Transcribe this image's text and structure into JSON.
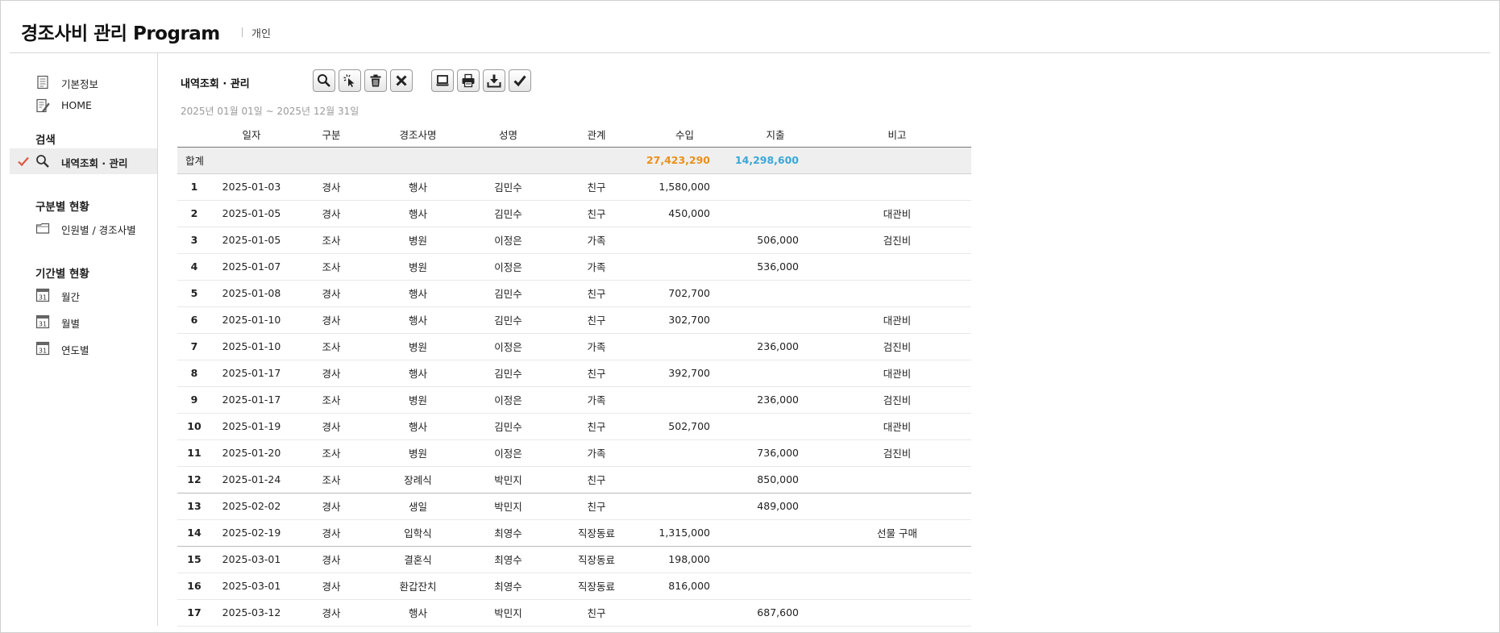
{
  "app": {
    "title": "경조사비 관리 Program",
    "subtitle": "개인"
  },
  "sidebar": {
    "top_items": [
      {
        "label": "기본정보",
        "icon": "document-icon"
      },
      {
        "label": "HOME",
        "icon": "edit-document-icon"
      }
    ],
    "sections": [
      {
        "title": "검색",
        "items": [
          {
            "label": "내역조회 · 관리",
            "icon": "search-icon",
            "active": true
          }
        ]
      },
      {
        "title": "구분별 현황",
        "items": [
          {
            "label": "인원별 / 경조사별",
            "icon": "folder-icon"
          }
        ]
      },
      {
        "title": "기간별 현황",
        "items": [
          {
            "label": "월간",
            "icon": "calendar-icon"
          },
          {
            "label": "월별",
            "icon": "calendar-icon"
          },
          {
            "label": "연도별",
            "icon": "calendar-icon"
          }
        ]
      }
    ],
    "calendar_day": "31"
  },
  "main": {
    "title": "내역조회 · 관리",
    "period": "2025년 01월 01일 ~ 2025년 12월 31일",
    "toolbar": [
      "search-icon",
      "pointer-click-icon",
      "trash-icon",
      "close-icon",
      "laptop-icon",
      "print-icon",
      "download-icon",
      "check-icon"
    ],
    "columns": [
      "일자",
      "구분",
      "경조사명",
      "성명",
      "관계",
      "수입",
      "지출",
      "비고"
    ],
    "total": {
      "label": "합계",
      "income": "27,423,290",
      "expense": "14,298,600"
    },
    "rows": [
      {
        "no": "1",
        "date": "2025-01-03",
        "type": "경사",
        "event": "행사",
        "name": "김민수",
        "relation": "친구",
        "income": "1,580,000",
        "expense": "",
        "note": ""
      },
      {
        "no": "2",
        "date": "2025-01-05",
        "type": "경사",
        "event": "행사",
        "name": "김민수",
        "relation": "친구",
        "income": "450,000",
        "expense": "",
        "note": "대관비"
      },
      {
        "no": "3",
        "date": "2025-01-05",
        "type": "조사",
        "event": "병원",
        "name": "이정은",
        "relation": "가족",
        "income": "",
        "expense": "506,000",
        "note": "검진비"
      },
      {
        "no": "4",
        "date": "2025-01-07",
        "type": "조사",
        "event": "병원",
        "name": "이정은",
        "relation": "가족",
        "income": "",
        "expense": "536,000",
        "note": ""
      },
      {
        "no": "5",
        "date": "2025-01-08",
        "type": "경사",
        "event": "행사",
        "name": "김민수",
        "relation": "친구",
        "income": "702,700",
        "expense": "",
        "note": ""
      },
      {
        "no": "6",
        "date": "2025-01-10",
        "type": "경사",
        "event": "행사",
        "name": "김민수",
        "relation": "친구",
        "income": "302,700",
        "expense": "",
        "note": "대관비"
      },
      {
        "no": "7",
        "date": "2025-01-10",
        "type": "조사",
        "event": "병원",
        "name": "이정은",
        "relation": "가족",
        "income": "",
        "expense": "236,000",
        "note": "검진비"
      },
      {
        "no": "8",
        "date": "2025-01-17",
        "type": "경사",
        "event": "행사",
        "name": "김민수",
        "relation": "친구",
        "income": "392,700",
        "expense": "",
        "note": "대관비"
      },
      {
        "no": "9",
        "date": "2025-01-17",
        "type": "조사",
        "event": "병원",
        "name": "이정은",
        "relation": "가족",
        "income": "",
        "expense": "236,000",
        "note": "검진비"
      },
      {
        "no": "10",
        "date": "2025-01-19",
        "type": "경사",
        "event": "행사",
        "name": "김민수",
        "relation": "친구",
        "income": "502,700",
        "expense": "",
        "note": "대관비"
      },
      {
        "no": "11",
        "date": "2025-01-20",
        "type": "조사",
        "event": "병원",
        "name": "이정은",
        "relation": "가족",
        "income": "",
        "expense": "736,000",
        "note": "검진비"
      },
      {
        "no": "12",
        "date": "2025-01-24",
        "type": "조사",
        "event": "장례식",
        "name": "박민지",
        "relation": "친구",
        "income": "",
        "expense": "850,000",
        "note": ""
      },
      {
        "no": "13",
        "date": "2025-02-02",
        "type": "경사",
        "event": "생일",
        "name": "박민지",
        "relation": "친구",
        "income": "",
        "expense": "489,000",
        "note": ""
      },
      {
        "no": "14",
        "date": "2025-02-19",
        "type": "경사",
        "event": "입학식",
        "name": "최영수",
        "relation": "직장동료",
        "income": "1,315,000",
        "expense": "",
        "note": "선물 구매"
      },
      {
        "no": "15",
        "date": "2025-03-01",
        "type": "경사",
        "event": "결혼식",
        "name": "최영수",
        "relation": "직장동료",
        "income": "198,000",
        "expense": "",
        "note": ""
      },
      {
        "no": "16",
        "date": "2025-03-01",
        "type": "경사",
        "event": "환갑잔치",
        "name": "최영수",
        "relation": "직장동료",
        "income": "816,000",
        "expense": "",
        "note": ""
      },
      {
        "no": "17",
        "date": "2025-03-12",
        "type": "경사",
        "event": "행사",
        "name": "박민지",
        "relation": "친구",
        "income": "",
        "expense": "687,600",
        "note": ""
      }
    ]
  },
  "colors": {
    "income_total": "#e8901c",
    "expense_total": "#3aa7d8",
    "active_check": "#e0573f"
  }
}
